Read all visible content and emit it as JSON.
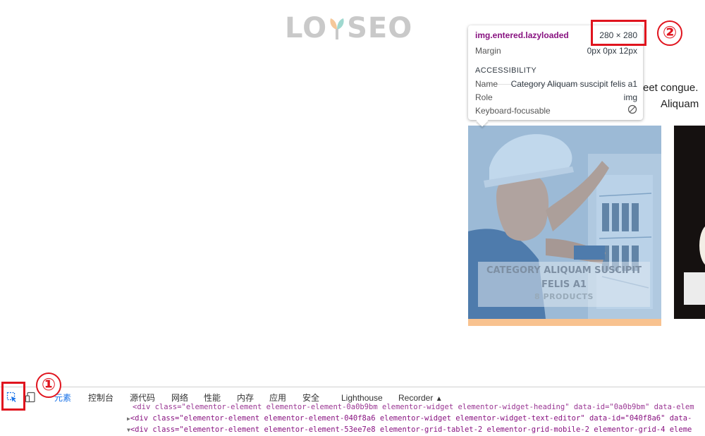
{
  "page": {
    "logo_text_left": "LO",
    "logo_text_right": "SEO",
    "text_line1": "eet congue.",
    "text_line2": "Aliquam",
    "category_title_line1": "CATEGORY ALIQUAM SUSCIPIT",
    "category_title_line2": "FELIS A1",
    "category_count": "8 PRODUCTS"
  },
  "tooltip": {
    "selector_tag": "img",
    "selector_classes": ".entered.lazyloaded",
    "dimensions": "280 × 280",
    "margin_label": "Margin",
    "margin_value": "0px 0px 12px",
    "accessibility_heading": "ACCESSIBILITY",
    "name_label": "Name",
    "name_value": "Category Aliquam suscipit felis a1",
    "role_label": "Role",
    "role_value": "img",
    "keyboard_label": "Keyboard-focusable"
  },
  "annotations": {
    "marker_1": "①",
    "marker_2": "②",
    "color": "#e0141e"
  },
  "devtools": {
    "tabs": [
      "元素",
      "控制台",
      "源代码",
      "网络",
      "性能",
      "内存",
      "应用",
      "安全",
      "Lighthouse",
      "Recorder"
    ],
    "active_tab": "元素",
    "code_lines": [
      "<div class=\"elementor-element elementor-element-0a0b9bm elementor-widget elementor-widget-heading\" data-id=\"0a0b9bm\" data-elem",
      "<div class=\"elementor-element elementor-element-040f8a6 elementor-widget elementor-widget-text-editor\" data-id=\"040f8a6\" data-",
      "<div class=\"elementor-element elementor-element-53ee7e8 elementor-grid-tablet-2 elementor-grid-mobile-2 elementor-grid-4 eleme"
    ],
    "accent_color": "#1a73e8"
  }
}
